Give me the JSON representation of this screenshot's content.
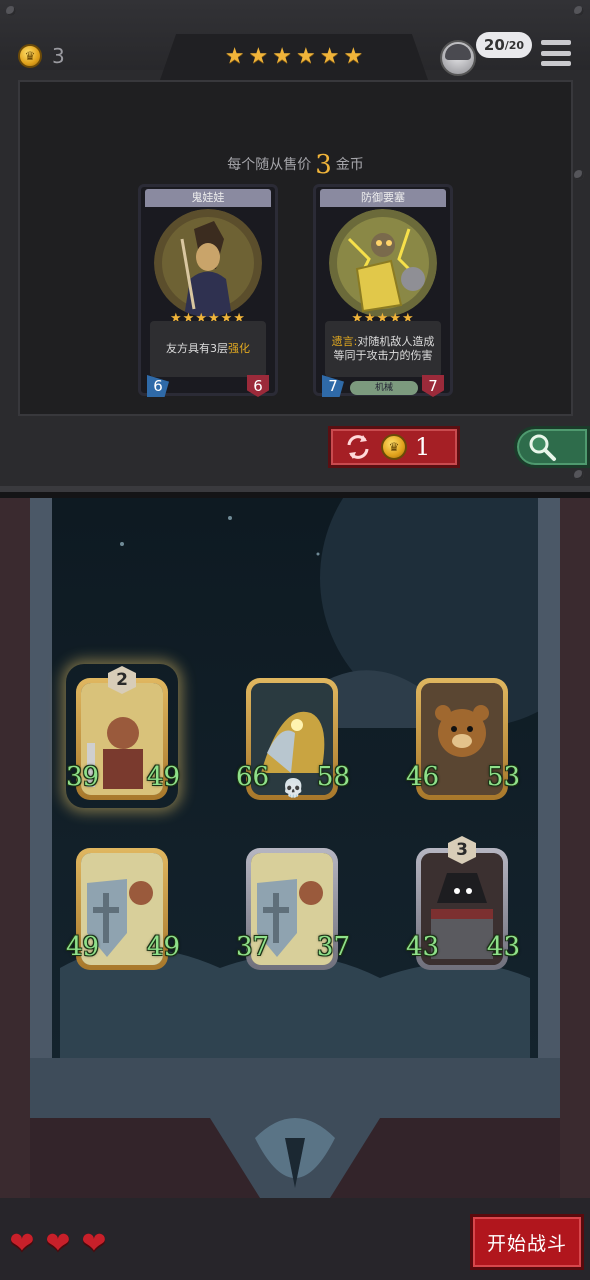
{
  "header": {
    "gold": "3",
    "tavern_stars": [
      "★",
      "★",
      "★",
      "★",
      "★",
      "★"
    ],
    "level_current": "20",
    "level_max": "/20",
    "gold_icon": "coin-icon",
    "menu_icon": "hamburger-menu-icon"
  },
  "shop": {
    "price_prefix": "每个随从售价",
    "price_value": "3",
    "price_suffix": "金币",
    "cards": [
      {
        "name": "鬼娃娃",
        "stars": "★★★★★★",
        "desc": "友方具有3层",
        "desc_highlight": "强化",
        "attack": "6",
        "health": "6"
      },
      {
        "name": "防御要塞",
        "stars": "★★★★★",
        "desc_highlight": "遗言:",
        "desc": "对随机敌人造成等同于攻击力的伤害",
        "tag": "机械",
        "attack": "7",
        "health": "7"
      }
    ],
    "refresh_cost": "1"
  },
  "board": {
    "minions": [
      {
        "attack": "39",
        "health": "49",
        "tier": "2",
        "frame": "gold"
      },
      {
        "attack": "66",
        "health": "58",
        "tier": "",
        "frame": "gold",
        "skull": "💀"
      },
      {
        "attack": "46",
        "health": "53",
        "tier": "",
        "frame": "gold"
      },
      {
        "attack": "49",
        "health": "49",
        "tier": "",
        "frame": "gold"
      },
      {
        "attack": "37",
        "health": "37",
        "tier": "",
        "frame": "silver"
      },
      {
        "attack": "43",
        "health": "43",
        "tier": "3",
        "frame": "silver"
      }
    ]
  },
  "footer": {
    "hearts": [
      "❤",
      "❤",
      "❤"
    ],
    "start_button": "开始战斗"
  },
  "colors": {
    "accent_gold": "#f0b43a",
    "stat_green": "#8fe08a",
    "button_red": "#a51f25",
    "search_green": "#2e6c4b"
  }
}
